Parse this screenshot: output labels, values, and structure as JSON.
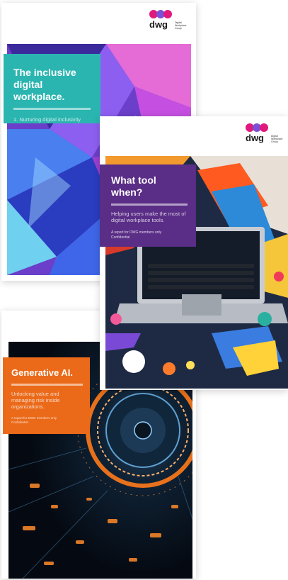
{
  "brand": {
    "logo_word": "dwg",
    "logo_sub": "Digital Workplace Group",
    "dot_colors": [
      "#e0197d",
      "#7b4fd6",
      "#e0197d"
    ]
  },
  "covers": [
    {
      "title": "The inclusive digital workplace.",
      "subtitle": "1. Nurturing digital inclusivity",
      "panel_color": "#2bb5b0"
    },
    {
      "title": "What tool when?",
      "subtitle": "Helping users make the most of digital workplace tools.",
      "note_line1": "A report for DWG members only",
      "note_line2": "Confidential",
      "panel_color": "#5a2d86"
    },
    {
      "title": "Generative AI.",
      "subtitle": "Unlocking value and managing risk inside organizations.",
      "note_line1": "A report for DWG members only",
      "note_line2": "Confidential",
      "panel_color": "#ea6a1a"
    }
  ]
}
